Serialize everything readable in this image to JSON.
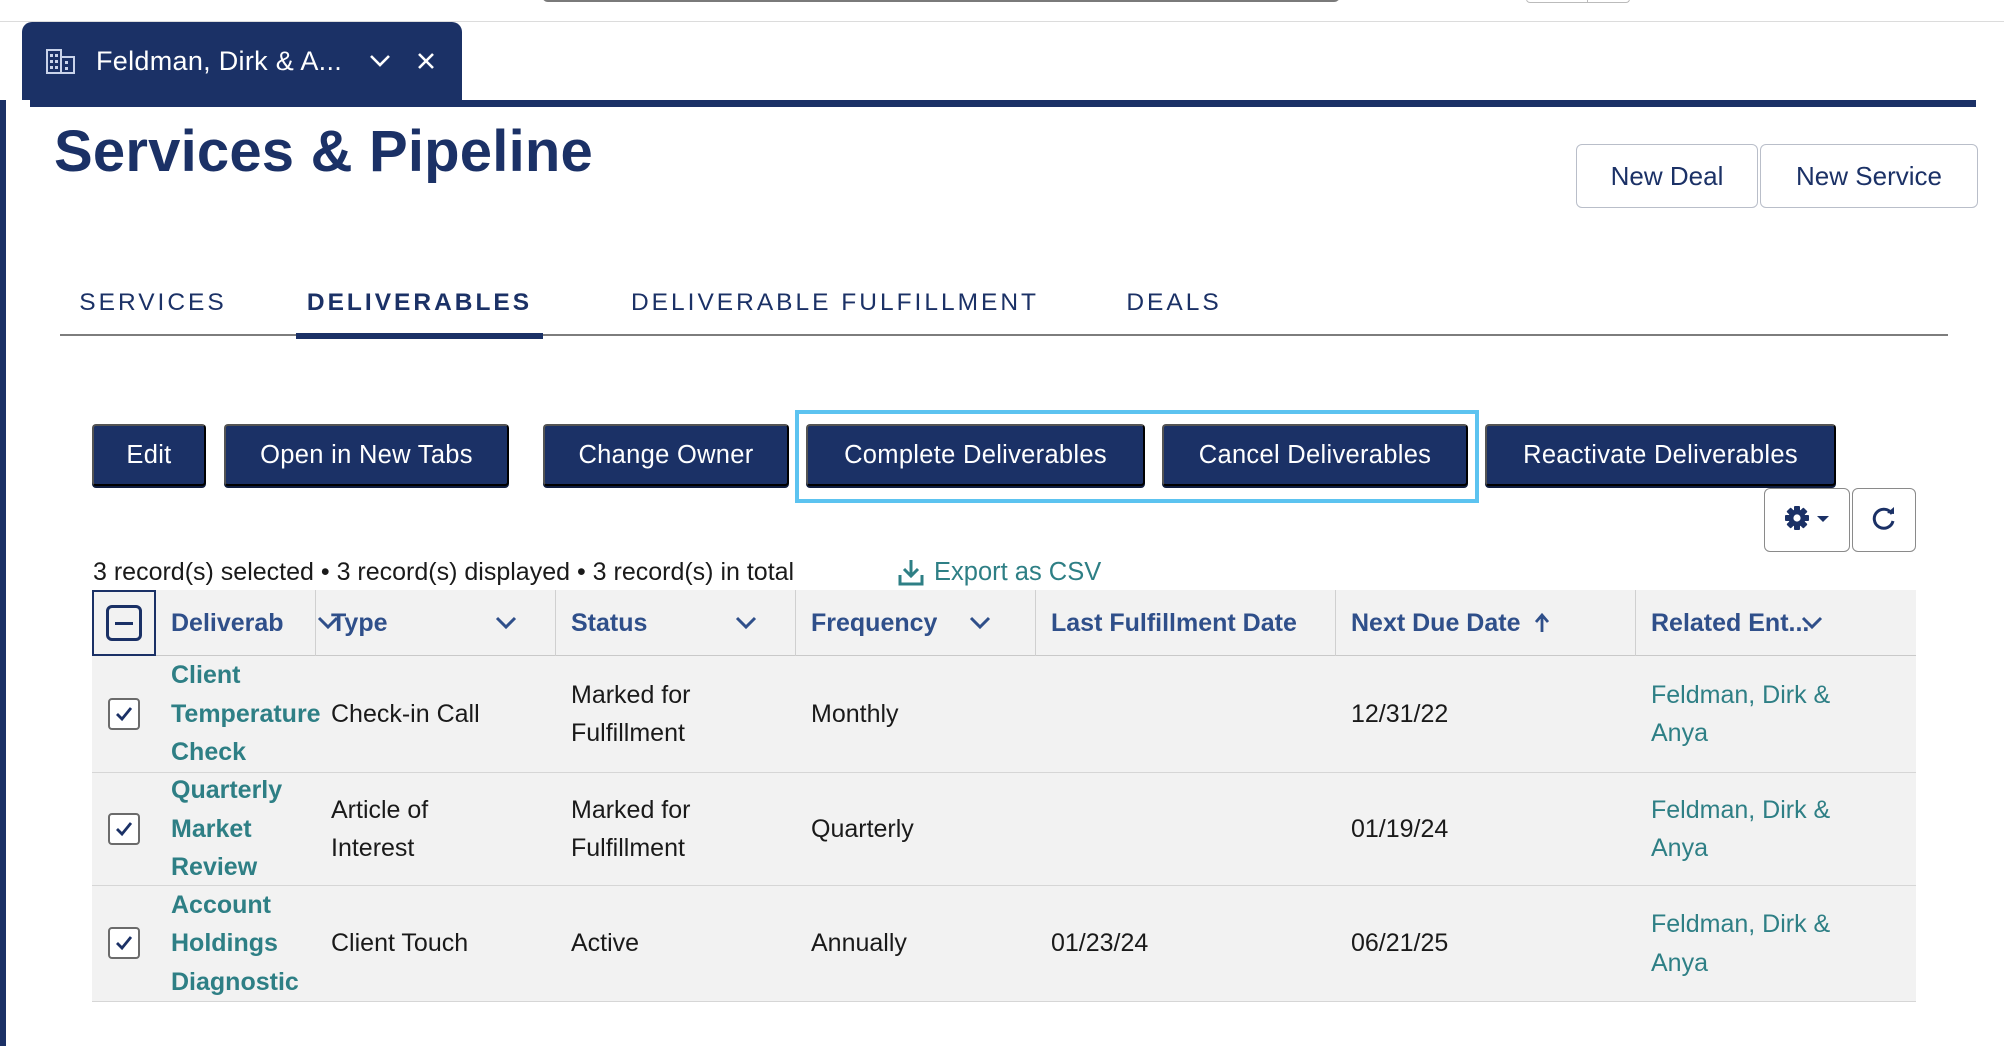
{
  "workspace_tab": {
    "label": "Feldman, Dirk & A...",
    "icon": "building-icon"
  },
  "page": {
    "title": "Services & Pipeline"
  },
  "header_buttons": {
    "new_deal": "New Deal",
    "new_service": "New Service"
  },
  "tabs": [
    {
      "label": "SERVICES",
      "active": false
    },
    {
      "label": "DELIVERABLES",
      "active": true
    },
    {
      "label": "DELIVERABLE FULFILLMENT",
      "active": false
    },
    {
      "label": "DEALS",
      "active": false
    }
  ],
  "actions": {
    "edit": "Edit",
    "open_new_tabs": "Open in New Tabs",
    "change_owner": "Change Owner",
    "complete": "Complete Deliverables",
    "cancel": "Cancel Deliverables",
    "reactivate": "Reactivate Deliverables"
  },
  "summary": "3 record(s) selected • 3 record(s) displayed • 3 record(s) in total",
  "export_label": "Export as CSV",
  "columns": {
    "deliverable": "Deliverable...",
    "type": "Type",
    "status": "Status",
    "frequency": "Frequency",
    "last_fulfillment": "Last Fulfillment Date",
    "next_due": "Next Due Date",
    "related": "Related Ent..."
  },
  "rows": [
    {
      "selected": true,
      "name_lines": [
        "Client",
        "Temperature",
        "Check"
      ],
      "type_lines": [
        "Check-in Call"
      ],
      "status_lines": [
        "Marked for",
        "Fulfillment"
      ],
      "frequency": "Monthly",
      "last_fulfillment": "",
      "next_due": "12/31/22",
      "related_lines": [
        "Feldman, Dirk &",
        "Anya"
      ]
    },
    {
      "selected": true,
      "name_lines": [
        "Quarterly",
        "Market Review"
      ],
      "type_lines": [
        "Article of",
        "Interest"
      ],
      "status_lines": [
        "Marked for",
        "Fulfillment"
      ],
      "frequency": "Quarterly",
      "last_fulfillment": "",
      "next_due": "01/19/24",
      "related_lines": [
        "Feldman, Dirk &",
        "Anya"
      ]
    },
    {
      "selected": true,
      "name_lines": [
        "Account",
        "Holdings",
        "Diagnostic"
      ],
      "type_lines": [
        "Client Touch"
      ],
      "status_lines": [
        "Active"
      ],
      "frequency": "Annually",
      "last_fulfillment": "01/23/24",
      "next_due": "06/21/25",
      "related_lines": [
        "Feldman, Dirk &",
        "Anya"
      ]
    }
  ],
  "colors": {
    "primary": "#1b3166",
    "link": "#2e7f85",
    "header_text": "#2f4f8a",
    "highlight": "#5cc3f0",
    "row_bg": "#f2f2f2"
  }
}
